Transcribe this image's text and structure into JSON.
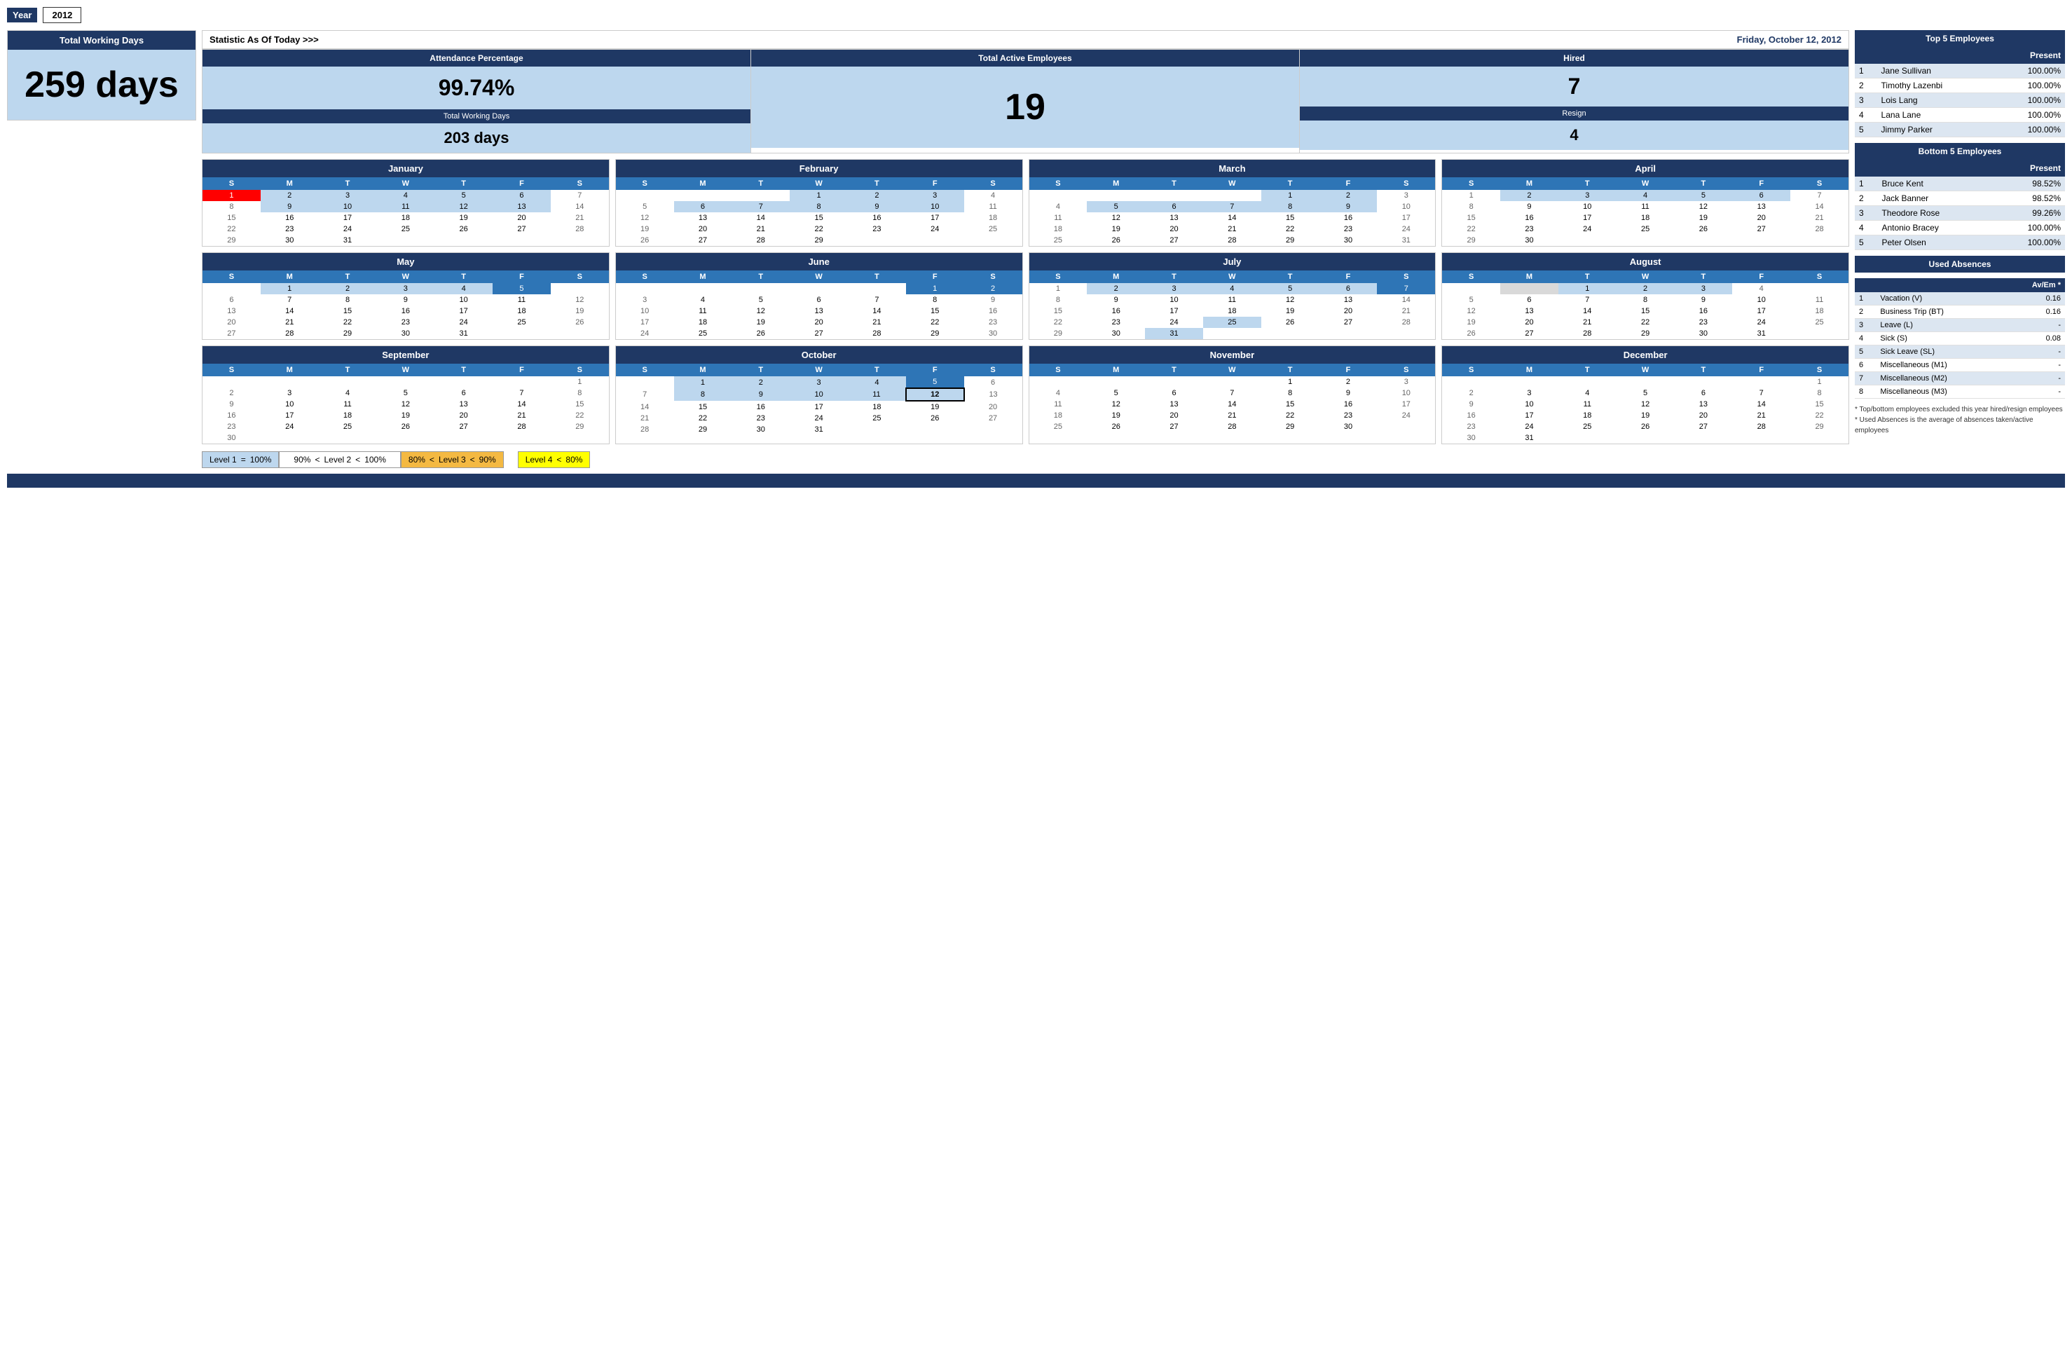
{
  "year": {
    "label": "Year",
    "value": "2012"
  },
  "totalWorkingDays": {
    "header": "Total Working Days",
    "value": "259 days"
  },
  "stats": {
    "header": "Statistic As Of Today   >>>",
    "date": "Friday, October 12, 2012",
    "attendance": {
      "label": "Attendance Percentage",
      "sublabel": "Total Working Days",
      "value": "99.74%",
      "days": "203 days"
    },
    "activeEmployees": {
      "label": "Total Active Employees",
      "value": "19"
    },
    "hired": {
      "label": "Hired",
      "value": "7",
      "resignLabel": "Resign",
      "resignValue": "4"
    }
  },
  "top5": {
    "header": "Top 5 Employees",
    "col_present": "Present",
    "employees": [
      {
        "rank": 1,
        "name": "Jane Sullivan",
        "present": "100.00%"
      },
      {
        "rank": 2,
        "name": "Timothy Lazenbi",
        "present": "100.00%"
      },
      {
        "rank": 3,
        "name": "Lois Lang",
        "present": "100.00%"
      },
      {
        "rank": 4,
        "name": "Lana Lane",
        "present": "100.00%"
      },
      {
        "rank": 5,
        "name": "Jimmy Parker",
        "present": "100.00%"
      }
    ]
  },
  "bottom5": {
    "header": "Bottom 5 Employees",
    "col_present": "Present",
    "employees": [
      {
        "rank": 1,
        "name": "Bruce Kent",
        "present": "98.52%"
      },
      {
        "rank": 2,
        "name": "Jack Banner",
        "present": "98.52%"
      },
      {
        "rank": 3,
        "name": "Theodore Rose",
        "present": "99.26%"
      },
      {
        "rank": 4,
        "name": "Antonio Bracey",
        "present": "100.00%"
      },
      {
        "rank": 5,
        "name": "Peter Olsen",
        "present": "100.00%"
      }
    ]
  },
  "usedAbsences": {
    "header": "Used Absences",
    "col_avem": "Av/Em *",
    "items": [
      {
        "rank": 1,
        "name": "Vacation (V)",
        "value": "0.16"
      },
      {
        "rank": 2,
        "name": "Business Trip (BT)",
        "value": "0.16"
      },
      {
        "rank": 3,
        "name": "Leave (L)",
        "value": "-"
      },
      {
        "rank": 4,
        "name": "Sick (S)",
        "value": "0.08"
      },
      {
        "rank": 5,
        "name": "Sick Leave (SL)",
        "value": "-"
      },
      {
        "rank": 6,
        "name": "Miscellaneous (M1)",
        "value": "-"
      },
      {
        "rank": 7,
        "name": "Miscellaneous (M2)",
        "value": "-"
      },
      {
        "rank": 8,
        "name": "Miscellaneous (M3)",
        "value": "-"
      }
    ]
  },
  "footnotes": {
    "line1": "* Top/bottom employees excluded this year hired/resign employees",
    "line2": "* Used Absences is the average of absences taken/active employees"
  },
  "legend": {
    "l1_pct": "100%",
    "l1_eq": "=",
    "l1_label": "Level 1",
    "l2_lo": "90%",
    "l2_lt1": "<",
    "l2_label": "Level 2",
    "l2_lt2": "<",
    "l2_hi": "100%",
    "l3_lo": "80%",
    "l3_lt1": "<",
    "l3_label": "Level 3",
    "l3_lt2": "<",
    "l3_hi": "90%",
    "l4_label": "Level 4",
    "l4_lt": "<",
    "l4_pct": "80%"
  },
  "months": [
    {
      "name": "January",
      "days": [
        [
          null,
          null,
          null,
          null,
          null,
          null,
          1,
          2,
          3
        ],
        [
          1,
          2,
          3,
          4,
          5,
          6,
          7
        ],
        [
          8,
          9,
          10,
          11,
          12,
          13,
          14
        ],
        [
          15,
          16,
          17,
          18,
          19,
          20,
          21
        ],
        [
          22,
          23,
          24,
          25,
          26,
          27,
          28
        ],
        [
          29,
          30,
          31,
          null,
          null,
          null,
          null
        ]
      ],
      "weekdays": [
        "S",
        "M",
        "T",
        "W",
        "T",
        "F",
        "S"
      ]
    }
  ]
}
